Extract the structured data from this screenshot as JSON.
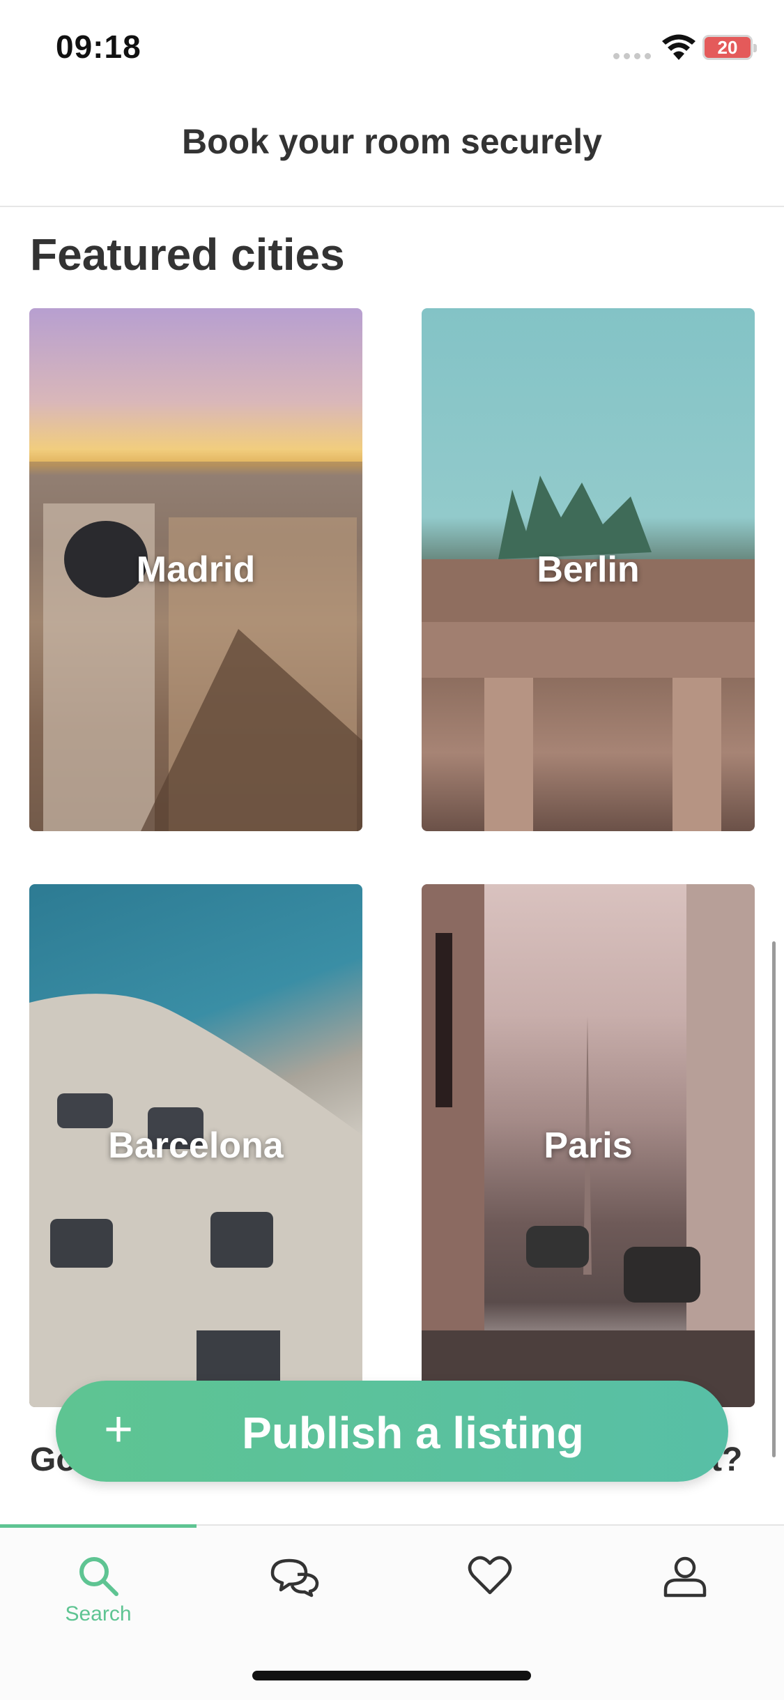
{
  "status_bar": {
    "time": "09:18",
    "battery": "20"
  },
  "header": {
    "title": "Book your room securely"
  },
  "section": {
    "title": "Featured cities"
  },
  "cities": [
    {
      "name": "Madrid"
    },
    {
      "name": "Berlin"
    },
    {
      "name": "Barcelona"
    },
    {
      "name": "Paris"
    }
  ],
  "partial_text": {
    "left": "Go",
    "right": "t?"
  },
  "fab": {
    "label": "Publish a listing",
    "icon": "plus-icon"
  },
  "tabbar": {
    "items": [
      {
        "label": "Search",
        "icon": "search-icon",
        "active": true
      },
      {
        "label": "",
        "icon": "chat-bubbles-icon",
        "active": false
      },
      {
        "label": "",
        "icon": "heart-icon",
        "active": false
      },
      {
        "label": "",
        "icon": "profile-icon",
        "active": false
      }
    ],
    "accent_color": "#5ec492"
  }
}
